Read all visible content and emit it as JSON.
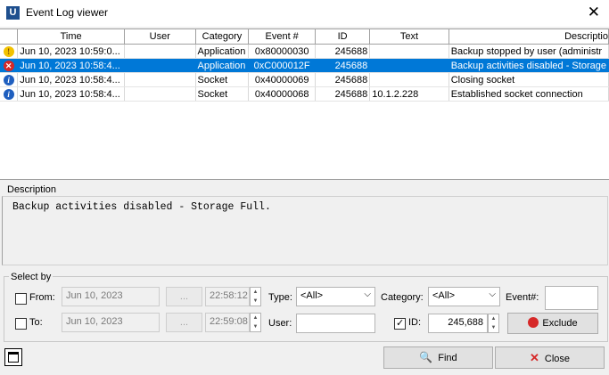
{
  "window": {
    "title": "Event Log viewer",
    "app_icon_letter": "U"
  },
  "table": {
    "columns": [
      "",
      "Time",
      "User",
      "Category",
      "Event #",
      "ID",
      "Text",
      "Descriptio"
    ],
    "rows": [
      {
        "icon": "warning-icon",
        "time": "Jun 10, 2023 10:59:0...",
        "user": "",
        "category": "Application",
        "event": "0x80000030",
        "id": "245688",
        "text": "",
        "description": "Backup stopped by user  (administr",
        "selected": false
      },
      {
        "icon": "error-icon",
        "time": "Jun 10, 2023 10:58:4...",
        "user": "",
        "category": "Application",
        "event": "0xC000012F",
        "id": "245688",
        "text": "",
        "description": "Backup activities disabled - Storage",
        "selected": true
      },
      {
        "icon": "info-icon",
        "time": "Jun 10, 2023 10:58:4...",
        "user": "",
        "category": "Socket",
        "event": "0x40000069",
        "id": "245688",
        "text": "",
        "description": "Closing socket",
        "selected": false
      },
      {
        "icon": "info-icon",
        "time": "Jun 10, 2023 10:58:4...",
        "user": "",
        "category": "Socket",
        "event": "0x40000068",
        "id": "245688",
        "text": "10.1.2.228",
        "description": "Established socket connection",
        "selected": false
      }
    ]
  },
  "description": {
    "label": "Description",
    "text": "Backup activities disabled - Storage Full."
  },
  "select_by": {
    "label": "Select by",
    "from": {
      "label": "From:",
      "checked": false,
      "date": "Jun 10, 2023",
      "ellipsis": "...",
      "time": "22:58:12"
    },
    "to": {
      "label": "To:",
      "checked": false,
      "date": "Jun 10, 2023",
      "ellipsis": "...",
      "time": "22:59:08"
    },
    "type": {
      "label": "Type:",
      "value": "<All>"
    },
    "category": {
      "label": "Category:",
      "value": "<All>"
    },
    "event_num": {
      "label": "Event#:",
      "value": ""
    },
    "user": {
      "label": "User:",
      "value": ""
    },
    "id": {
      "label": "ID:",
      "checked": true,
      "value": "245,688"
    },
    "exclude_label": "Exclude"
  },
  "buttons": {
    "find": "Find",
    "close": "Close"
  },
  "colors": {
    "selection": "#0078d7",
    "app_icon": "#1e4f8e",
    "error": "#d62828",
    "info": "#1f5fbf",
    "warning": "#f2c200"
  }
}
